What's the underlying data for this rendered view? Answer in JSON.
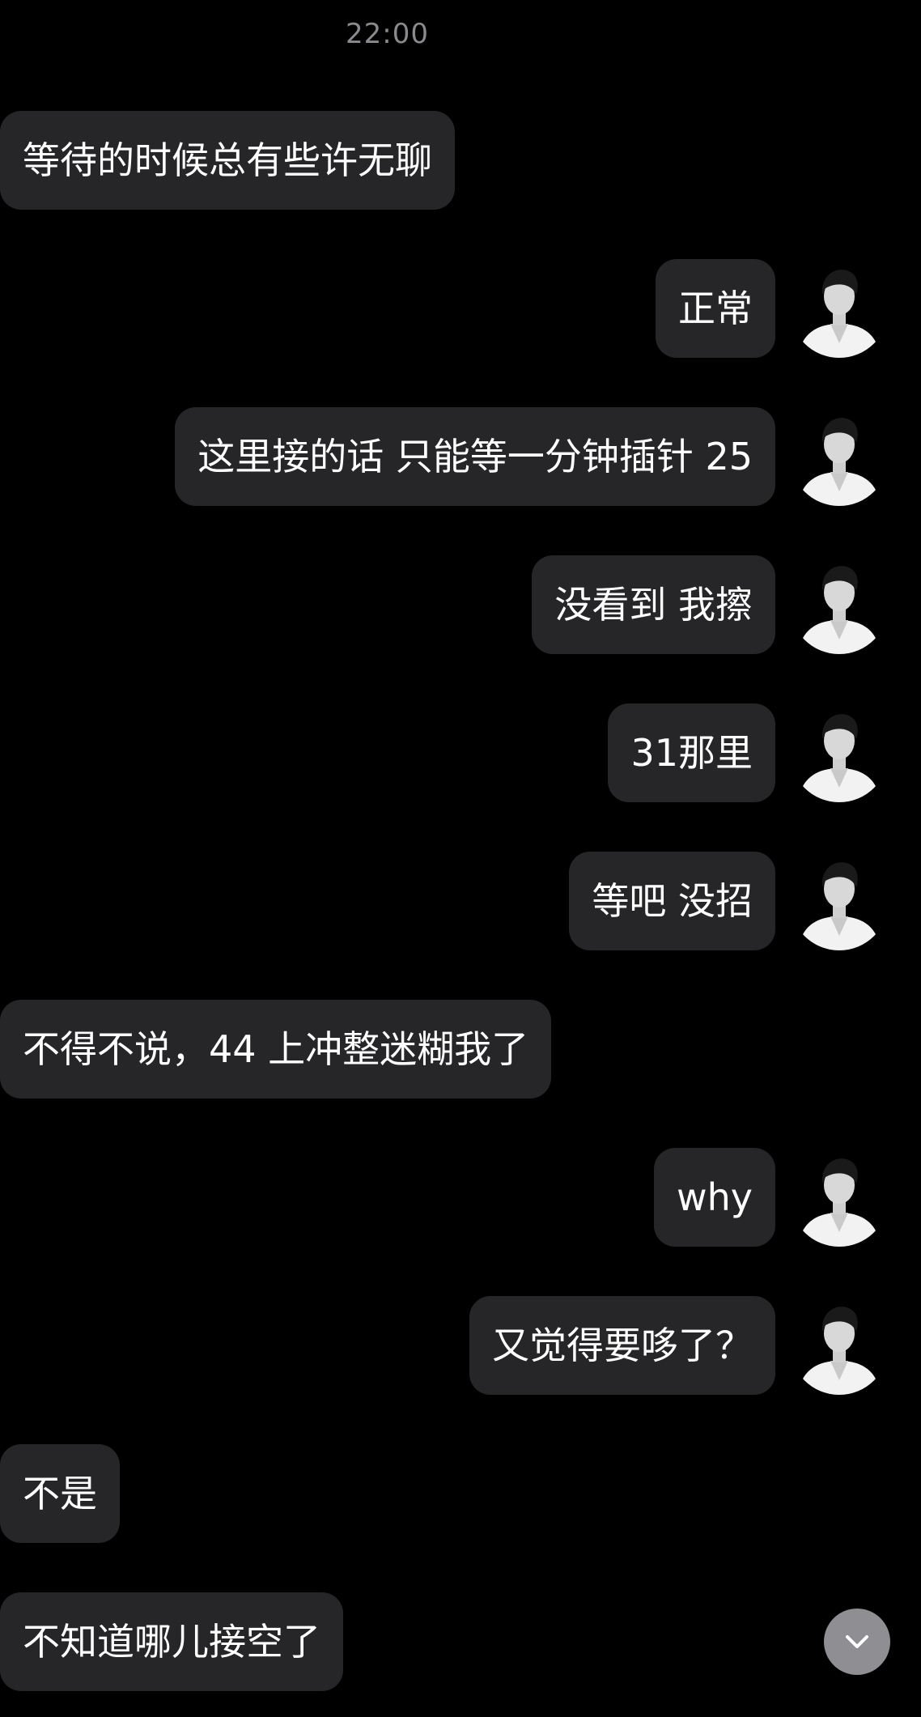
{
  "chat": {
    "timestamp": "22:00",
    "messages": [
      {
        "direction": "incoming",
        "text": "等待的时候总有些许无聊"
      },
      {
        "direction": "outgoing",
        "text": "正常"
      },
      {
        "direction": "outgoing",
        "text": "这里接的话 只能等一分钟插针 25"
      },
      {
        "direction": "outgoing",
        "text": "没看到 我擦"
      },
      {
        "direction": "outgoing",
        "text": "31那里"
      },
      {
        "direction": "outgoing",
        "text": "等吧 没招"
      },
      {
        "direction": "incoming",
        "text": "不得不说，44 上冲整迷糊我了"
      },
      {
        "direction": "outgoing",
        "text": "why"
      },
      {
        "direction": "outgoing",
        "text": "又觉得要哆了？"
      },
      {
        "direction": "incoming",
        "text": "不是"
      },
      {
        "direction": "incoming",
        "text": "不知道哪儿接空了"
      }
    ]
  },
  "icons": {
    "avatar": "user-avatar-photo",
    "scroll_button": "chevron-down-icon"
  },
  "colors": {
    "background": "#000000",
    "bubble": "#262628",
    "text": "#ffffff",
    "timestamp": "#8a8a8e",
    "scroll_button": "#8e8e93"
  }
}
